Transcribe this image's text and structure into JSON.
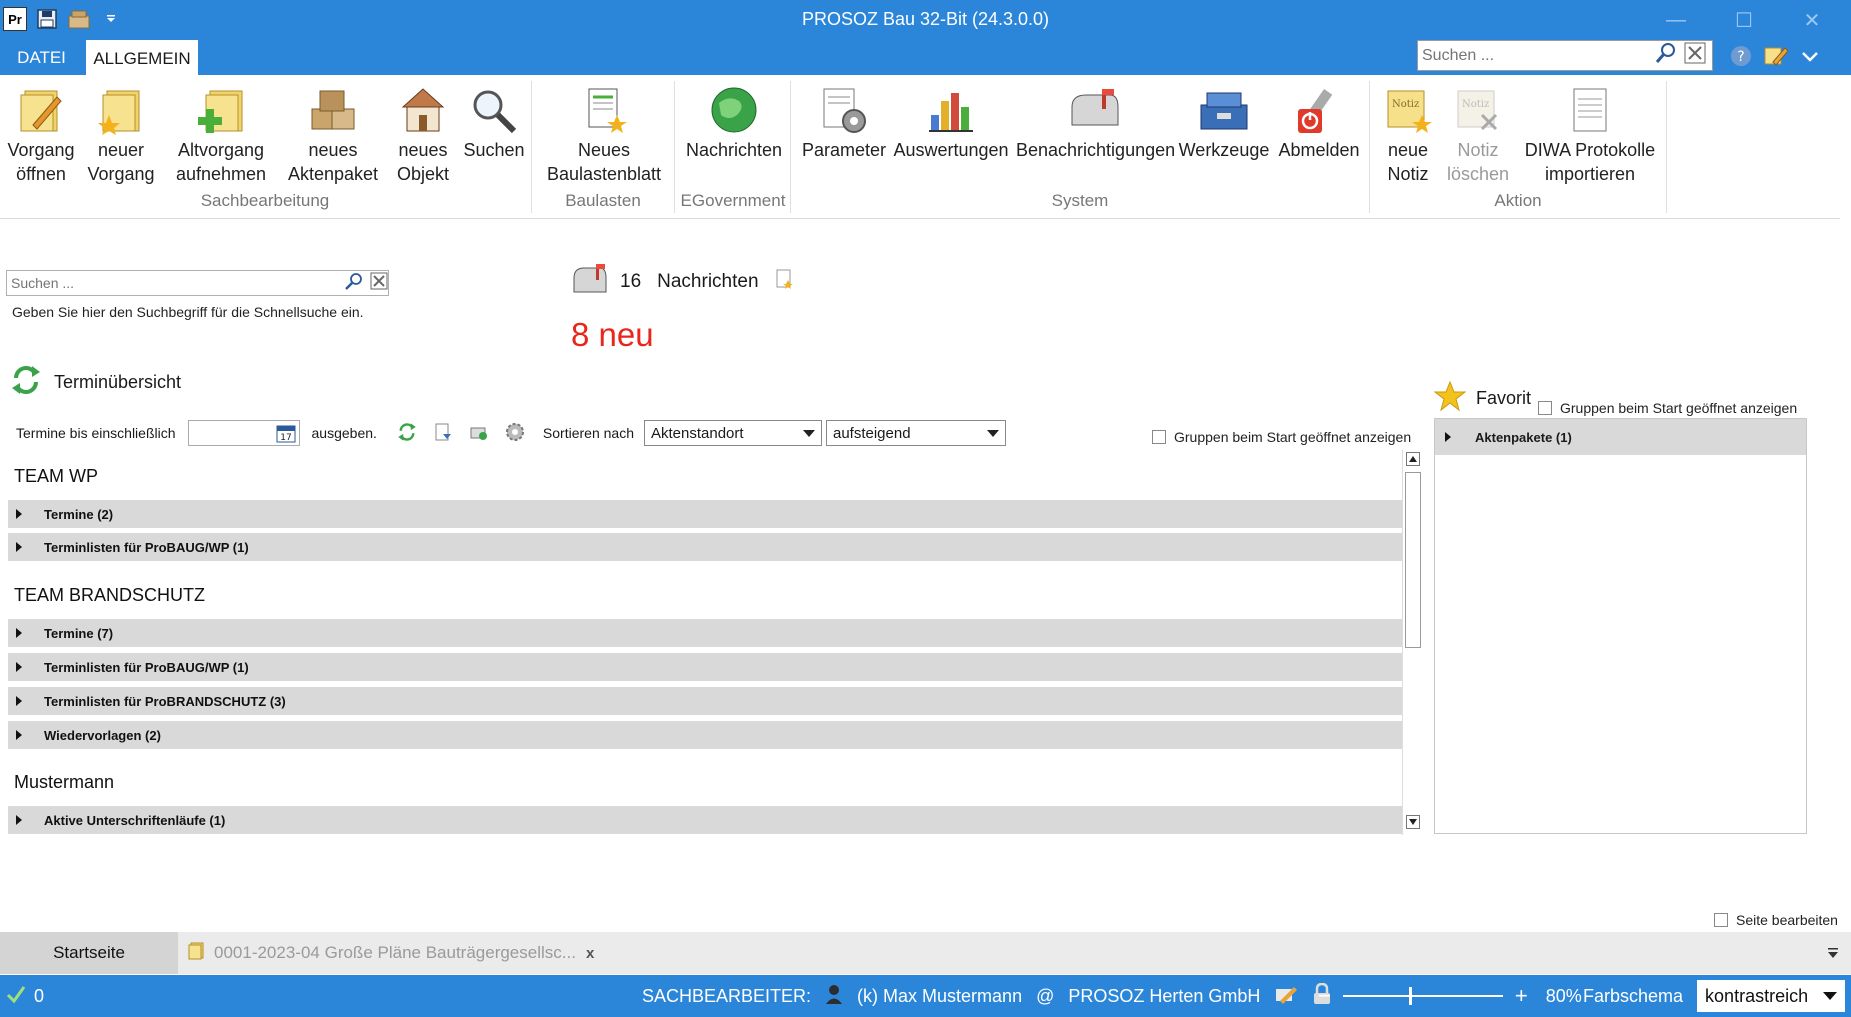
{
  "window": {
    "title": "PROSOZ Bau 32-Bit (24.3.0.0)",
    "logo_text": "Pr"
  },
  "ribbon_tabs": {
    "file": "DATEI",
    "general": "ALLGEMEIN"
  },
  "top_search": {
    "placeholder": "Suchen ..."
  },
  "ribbon": {
    "buttons": [
      {
        "label1": "Vorgang",
        "label2": "öffnen"
      },
      {
        "label1": "neuer",
        "label2": "Vorgang"
      },
      {
        "label1": "Altvorgang",
        "label2": "aufnehmen"
      },
      {
        "label1": "neues",
        "label2": "Aktenpaket"
      },
      {
        "label1": "neues",
        "label2": "Objekt"
      },
      {
        "label1": "Suchen",
        "label2": ""
      },
      {
        "label1": "Neues",
        "label2": "Baulastenblatt"
      },
      {
        "label1": "Nachrichten",
        "label2": ""
      },
      {
        "label1": "Parameter",
        "label2": ""
      },
      {
        "label1": "Auswertungen",
        "label2": ""
      },
      {
        "label1": "Benachrichtigungen",
        "label2": ""
      },
      {
        "label1": "Werkzeuge",
        "label2": ""
      },
      {
        "label1": "Abmelden",
        "label2": ""
      },
      {
        "label1": "neue",
        "label2": "Notiz"
      },
      {
        "label1": "Notiz",
        "label2": "löschen"
      },
      {
        "label1": "DIWA Protokolle",
        "label2": "importieren"
      }
    ],
    "groups": [
      "Sachbearbeitung",
      "Baulasten",
      "EGovernment",
      "System",
      "Aktion"
    ]
  },
  "quick_search": {
    "placeholder": "Suchen ...",
    "hint": "Geben Sie hier den Suchbegriff für die Schnellsuche ein."
  },
  "messages": {
    "count": "16",
    "label": "Nachrichten",
    "new_text": "8 neu"
  },
  "termin": {
    "title": "Terminübersicht",
    "until_label": "Termine bis einschließlich",
    "output_label": "ausgeben.",
    "date_icon_text": "17",
    "sort_label": "Sortieren nach",
    "sort_field": "Aktenstandort",
    "sort_order": "aufsteigend",
    "groups_checkbox": "Gruppen beim Start geöffnet anzeigen",
    "groups": [
      {
        "name": "TEAM WP",
        "rows": [
          "Termine (2)",
          "Terminlisten für ProBAUG/WP (1)"
        ]
      },
      {
        "name": "TEAM BRANDSCHUTZ",
        "rows": [
          "Termine (7)",
          "Terminlisten für ProBAUG/WP (1)",
          "Terminlisten für ProBRANDSCHUTZ (3)",
          "Wiedervorlagen (2)"
        ]
      },
      {
        "name": "Mustermann",
        "rows": [
          "Aktive Unterschriftenläufe (1)"
        ]
      }
    ]
  },
  "favorites": {
    "title": "Favorit",
    "groups_checkbox": "Gruppen beim Start geöffnet anzeigen",
    "rows": [
      "Aktenpakete (1)"
    ]
  },
  "page_edit_checkbox": "Seite bearbeiten",
  "bottom_tabs": {
    "start": "Startseite",
    "doc": "0001-2023-04 Große Pläne Bauträgergesellsc...",
    "doc_close": "x"
  },
  "status": {
    "count": "0",
    "clerk_label": "SACHBEARBEITER:",
    "clerk_name": "(k) Max Mustermann",
    "at": "@",
    "org": "PROSOZ Herten GmbH",
    "zoom_minus": "−",
    "zoom_plus": "+",
    "zoom_value": "80%",
    "scheme_label": "Farbschema",
    "scheme_value": "kontrastreich"
  },
  "colors": {
    "accent": "#2b86d9",
    "new_count": "#e8261b",
    "row_bg": "#d9d9d9"
  }
}
